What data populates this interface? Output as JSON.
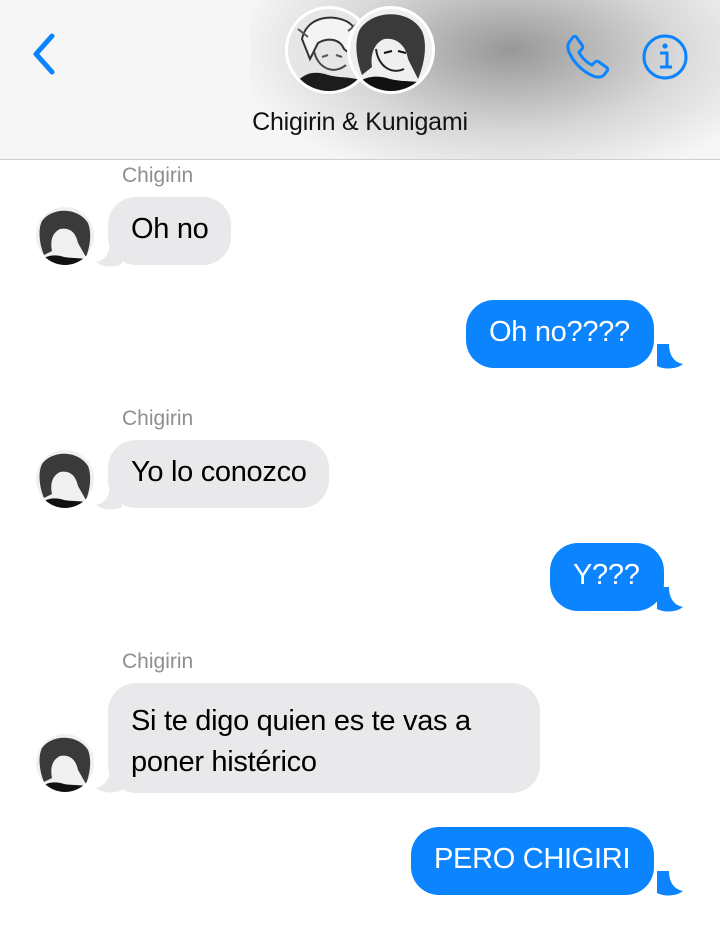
{
  "header": {
    "back_icon": "chevron-left-icon",
    "title": "Chigirin & Kunigami",
    "call_icon": "phone-icon",
    "info_icon": "info-icon",
    "accent": "#0b84fe"
  },
  "messages": [
    {
      "direction": "incoming",
      "sender": "Chigirin",
      "text": "Oh no"
    },
    {
      "direction": "outgoing",
      "text": "Oh no????"
    },
    {
      "direction": "incoming",
      "sender": "Chigirin",
      "text": "Yo lo conozco"
    },
    {
      "direction": "outgoing",
      "text": "Y???"
    },
    {
      "direction": "incoming",
      "sender": "Chigirin",
      "lines": [
        "Si te digo quien es te vas a",
        "poner histérico"
      ]
    },
    {
      "direction": "outgoing",
      "text": "PERO CHIGIRI"
    }
  ],
  "colors": {
    "incoming_bubble": "#e9e9eb",
    "outgoing_bubble": "#0b84fe",
    "sender_label": "#8e8e93"
  }
}
